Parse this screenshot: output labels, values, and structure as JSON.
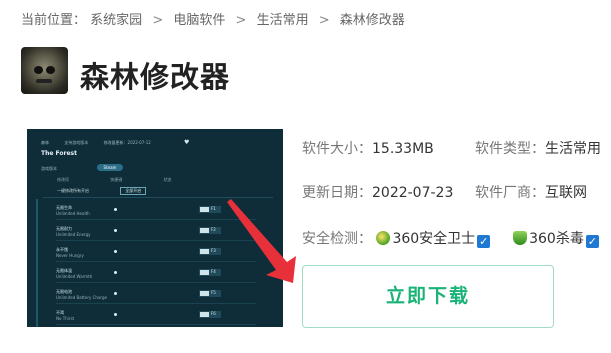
{
  "breadcrumb": {
    "prefix": "当前位置：",
    "items": [
      "系统家园",
      "电脑软件",
      "生活常用",
      "森林修改器"
    ],
    "separator": ">"
  },
  "app": {
    "title": "森林修改器"
  },
  "screenshot_preview": {
    "header_fields": [
      "森林",
      "支持游戏版本",
      "修改器更新：2022-07-12"
    ],
    "game_title": "The Forest",
    "version_label": "游戏版本",
    "platform_pill": "Steam",
    "columns": [
      "修改项",
      "快捷键",
      "状态"
    ],
    "onekey_label": "一键修改所有开启",
    "onekey_button": "全部开启",
    "rows": [
      {
        "cn": "无限生命",
        "en": "Unlimited Health",
        "key": "F1"
      },
      {
        "cn": "无限耐力",
        "en": "Unlimited Energy",
        "key": "F2"
      },
      {
        "cn": "永不饿",
        "en": "Never Hungry",
        "key": "F3"
      },
      {
        "cn": "无限体温",
        "en": "Unlimited Warmth",
        "key": "F4"
      },
      {
        "cn": "无限电池",
        "en": "Unlimited Battery Charge",
        "key": "F5"
      },
      {
        "cn": "不渴",
        "en": "No Thirst",
        "key": "F6"
      },
      {
        "cn": "轻松制造",
        "en": "Easy Crafting",
        "key": "F7"
      }
    ]
  },
  "info": {
    "size_label": "软件大小：",
    "size_value": "15.33MB",
    "type_label": "软件类型：",
    "type_value": "生活常用",
    "date_label": "更新日期：",
    "date_value": "2022-07-23",
    "vendor_label": "软件厂商：",
    "vendor_value": "互联网",
    "security_label": "安全检测：",
    "security_items": [
      "360安全卫士",
      "360杀毒"
    ]
  },
  "download_button": "立即下载",
  "colors": {
    "download_text": "#1ab377",
    "download_border": "#9fdcc3",
    "arrow": "#e8303a",
    "check": "#1f78d1",
    "preview_bg": "#0e2d38"
  }
}
